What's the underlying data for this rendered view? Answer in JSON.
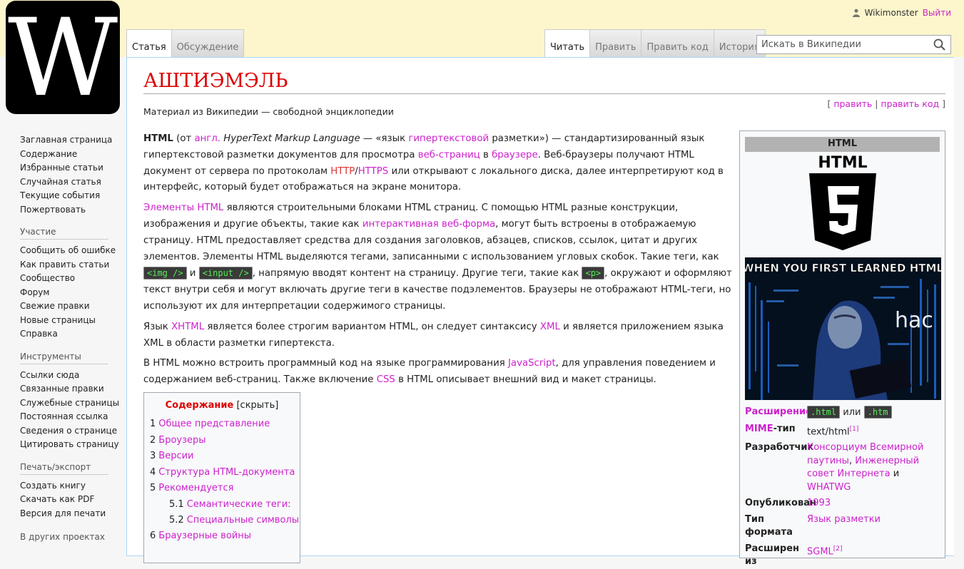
{
  "personal": {
    "username": "Wikimonster",
    "logout": "Выйти"
  },
  "namespace_tabs": [
    {
      "label": "Статья",
      "selected": true
    },
    {
      "label": "Обсуждение",
      "selected": false
    }
  ],
  "view_tabs": [
    {
      "label": "Читать",
      "selected": true
    },
    {
      "label": "Править",
      "selected": false
    },
    {
      "label": "Править код",
      "selected": false
    },
    {
      "label": "История",
      "selected": false
    }
  ],
  "search": {
    "placeholder": "Искать в Википедии"
  },
  "page": {
    "title": "АШТИЭМЭЛЬ",
    "sitesub": "Материал из Википедии — свободной энциклопедии",
    "edit": "править",
    "edit_source": "править код"
  },
  "para1": {
    "a": "HTML",
    "b": " (от ",
    "c": "англ.",
    "d": " ",
    "e": "HyperText Markup Language",
    "f": " — «язык ",
    "g": "гипертекстовой",
    "h": " разметки») — стандартизированный язык гипертекстовой разметки документов для просмотра ",
    "i": "веб-страниц",
    "j": " в ",
    "k": "браузере",
    "l": ". Веб-браузеры получают HTML документ от сервера по протоколам ",
    "m": "HTTP",
    "n": "/",
    "o": "HTTPS",
    "p": " или открывают с локального диска, далее интерпретируют код в интерфейс, который будет отображаться на экране монитора."
  },
  "para2": {
    "a": "Элементы HTML",
    "b": " являются строительными блоками HTML страниц. С помощью HTML разные конструкции, изображения и другие объекты, такие как ",
    "c": "интерактивная веб-форма",
    "d": ", могут быть встроены в отображаемую страницу. HTML предоставляет средства для создания заголовков, абзацев, списков, ссылок, цитат и других элементов. Элементы HTML выделяются тегами, записанными с использованием угловых скобок. Такие теги, как ",
    "e": "<img />",
    "f": " и ",
    "g": "<input />",
    "h": ", напрямую вводят контент на страницу. Другие теги, такие как ",
    "i": "<p>",
    "j": ", окружают и оформляют текст внутри себя и могут включать другие теги в качестве подэлементов. Браузеры не отображают HTML-теги, но используют их для интерпретации содержимого страницы."
  },
  "para3": {
    "a": "Язык ",
    "b": "XHTML",
    "c": " является более строгим вариантом HTML, он следует синтаксису ",
    "d": "XML",
    "e": " и является приложением языка XML в области разметки гипертекста."
  },
  "para4": {
    "a": "В HTML можно встроить программный код на языке программирования ",
    "b": "JavaScript",
    "c": ", для управления поведением и содержанием веб-страниц. Также включение ",
    "d": "CSS",
    "e": " в HTML описывает внешний вид и макет страницы."
  },
  "toc": {
    "title": "Содержание",
    "toggle": "[скрыть]",
    "items": [
      {
        "num": "1",
        "label": "Общее представление"
      },
      {
        "num": "2",
        "label": "Броузеры"
      },
      {
        "num": "3",
        "label": "Версии"
      },
      {
        "num": "4",
        "label": "Структура HTML-документа"
      },
      {
        "num": "5",
        "label": "Рекомендуется"
      },
      {
        "num": "5.1",
        "label": "Семантические теги:"
      },
      {
        "num": "5.2",
        "label": "Специальные символы"
      },
      {
        "num": "6",
        "label": "Браузерные войны"
      }
    ]
  },
  "infobox": {
    "heading": "HTML",
    "logo_caption": "HTML",
    "meme_top": "WHEN YOU FIRST LEARNED HTML",
    "meme_word": "hac",
    "rows": {
      "ext_key": "Расширение",
      "ext_a": ".html",
      "ext_or": "или",
      "ext_b": ".htm",
      "mime_key_a": "MIME",
      "mime_key_b": "-тип",
      "mime_val": "text/html",
      "mime_ref": "[1]",
      "dev_key": "Разработчик",
      "dev_a": "Консорциум Всемирной паутины",
      "dev_b": ", ",
      "dev_c": "Инженерный совет Интернета",
      "dev_d": " и ",
      "dev_e": "WHATWG",
      "pub_key": "Опубликован",
      "pub_val": "1993",
      "type_key": "Тип формата",
      "type_val": "Язык разметки",
      "extfrom_key": "Расширен из",
      "extfrom_val": "SGML",
      "extfrom_ref": "[2]"
    }
  },
  "sidebar": {
    "nav": [
      "Заглавная страница",
      "Содержание",
      "Избранные статьи",
      "Случайная статья",
      "Текущие события",
      "Пожертвовать"
    ],
    "participation_head": "Участие",
    "participation": [
      "Сообщить об ошибке",
      "Как править статьи",
      "Сообщество",
      "Форум",
      "Свежие правки",
      "Новые страницы",
      "Справка"
    ],
    "tools_head": "Инструменты",
    "tools": [
      "Ссылки сюда",
      "Связанные правки",
      "Служебные страницы",
      "Постоянная ссылка",
      "Сведения о странице",
      "Цитировать страницу"
    ],
    "print_head": "Печать/экспорт",
    "print": [
      "Создать книгу",
      "Скачать как PDF",
      "Версия для печати"
    ],
    "other_head": "В других проектах"
  },
  "colors": {
    "link": "#cc22cc",
    "title": "#dd0000",
    "topband": "#fdf6cc"
  }
}
